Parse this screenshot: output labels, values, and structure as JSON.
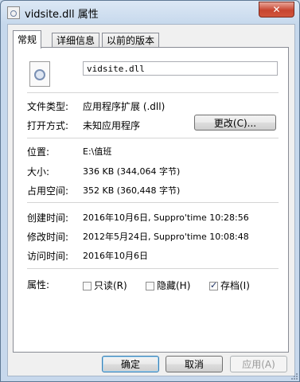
{
  "window": {
    "title": "vidsite.dll 属性",
    "close_glyph": "✕"
  },
  "tabs": [
    {
      "label": "常规"
    },
    {
      "label": "详细信息"
    },
    {
      "label": "以前的版本"
    }
  ],
  "general": {
    "file_name": "vidsite.dll",
    "file_type_label": "文件类型:",
    "file_type_value": "应用程序扩展 (.dll)",
    "opens_with_label": "打开方式:",
    "opens_with_value": "未知应用程序",
    "change_button": "更改(C)...",
    "location_label": "位置:",
    "location_value": "E:\\值班",
    "size_label": "大小:",
    "size_value": "336 KB (344,064 字节)",
    "size_on_disk_label": "占用空间:",
    "size_on_disk_value": "352 KB (360,448 字节)",
    "created_label": "创建时间:",
    "created_value": "2016年10月6日, Suppro'time 10:28:56",
    "modified_label": "修改时间:",
    "modified_value": "2012年5月24日, Suppro'time 10:08:48",
    "accessed_label": "访问时间:",
    "accessed_value": "2016年10月6日",
    "attributes_label": "属性:",
    "attr_readonly": "只读(R)",
    "attr_hidden": "隐藏(H)",
    "attr_archive": "存档(I)"
  },
  "attributes_state": {
    "readonly": false,
    "hidden": false,
    "archive": true
  },
  "footer": {
    "ok": "确定",
    "cancel": "取消",
    "apply": "应用(A)"
  },
  "icons": {
    "title": "dll-file-icon",
    "file": "dll-file-icon"
  }
}
